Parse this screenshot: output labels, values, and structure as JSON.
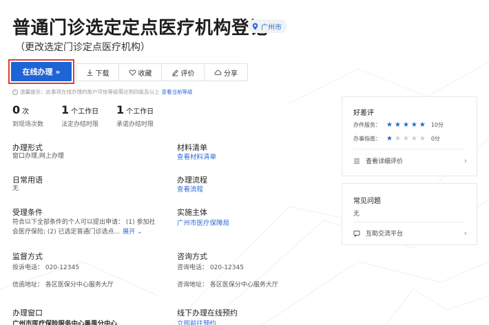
{
  "header": {
    "title": "普通门诊选定定点医疗机构登记",
    "location": "广州市",
    "subtitle": "（更改选定门诊定点医疗机构）"
  },
  "actions": {
    "online": "在线办理 »",
    "download": "下载",
    "favorite": "收藏",
    "review": "评价",
    "share": "分享"
  },
  "notice": {
    "text": "温馨提示：此事项在线办理的账户可信等级需达到四级及以上",
    "link": "查看当前等级"
  },
  "stats": [
    {
      "num": "0",
      "unit": "次",
      "label": "到现场次数"
    },
    {
      "num": "1",
      "unit": "个工作日",
      "label": "法定办结时限"
    },
    {
      "num": "1",
      "unit": "个工作日",
      "label": "承诺办结时限"
    }
  ],
  "sections": {
    "handle_form": {
      "label": "办理形式",
      "value": "窗口办理,网上办理"
    },
    "materials": {
      "label": "材料清单",
      "link": "查看材料清单"
    },
    "terms": {
      "label": "日常用语",
      "value": "无"
    },
    "process": {
      "label": "办理流程",
      "link": "查看流程"
    },
    "conditions": {
      "label": "受理条件",
      "line1": "符合以下全部条件的个人可以提出申请：   (1) 参加社",
      "line2": "会医疗保险;   (2) 已选定普通门诊选点...",
      "expand": "展开 ⌄"
    },
    "subject": {
      "label": "实施主体",
      "link": "广州市医疗保障局"
    },
    "supervise": {
      "label": "监督方式",
      "phone": "投诉电话：  020-12345",
      "address": "信函地址：  各区医保分中心服务大厅"
    },
    "consult": {
      "label": "咨询方式",
      "phone": "咨询电话：  020-12345",
      "address": "咨询地址：  各区医保分中心服务大厅"
    },
    "window": {
      "label": "办理窗口",
      "value": "广州市医疗保险服务中心番禺分中心"
    },
    "booking": {
      "label": "线下办理在线预约",
      "link": "立即前往预约"
    }
  },
  "rating_card": {
    "title": "好差评",
    "service_label": "办件服务：",
    "service_score": "10分",
    "service_stars": 5,
    "guide_label": "办事指南：",
    "guide_score": "0分",
    "guide_stars": 1,
    "detail_link": "查看详细评价"
  },
  "faq_card": {
    "title": "常见问题",
    "value": "无",
    "link": "互助交流平台"
  },
  "colors": {
    "primary": "#1d64d6",
    "highlight_border": "#e23a2e",
    "link": "#2f6bd9"
  }
}
